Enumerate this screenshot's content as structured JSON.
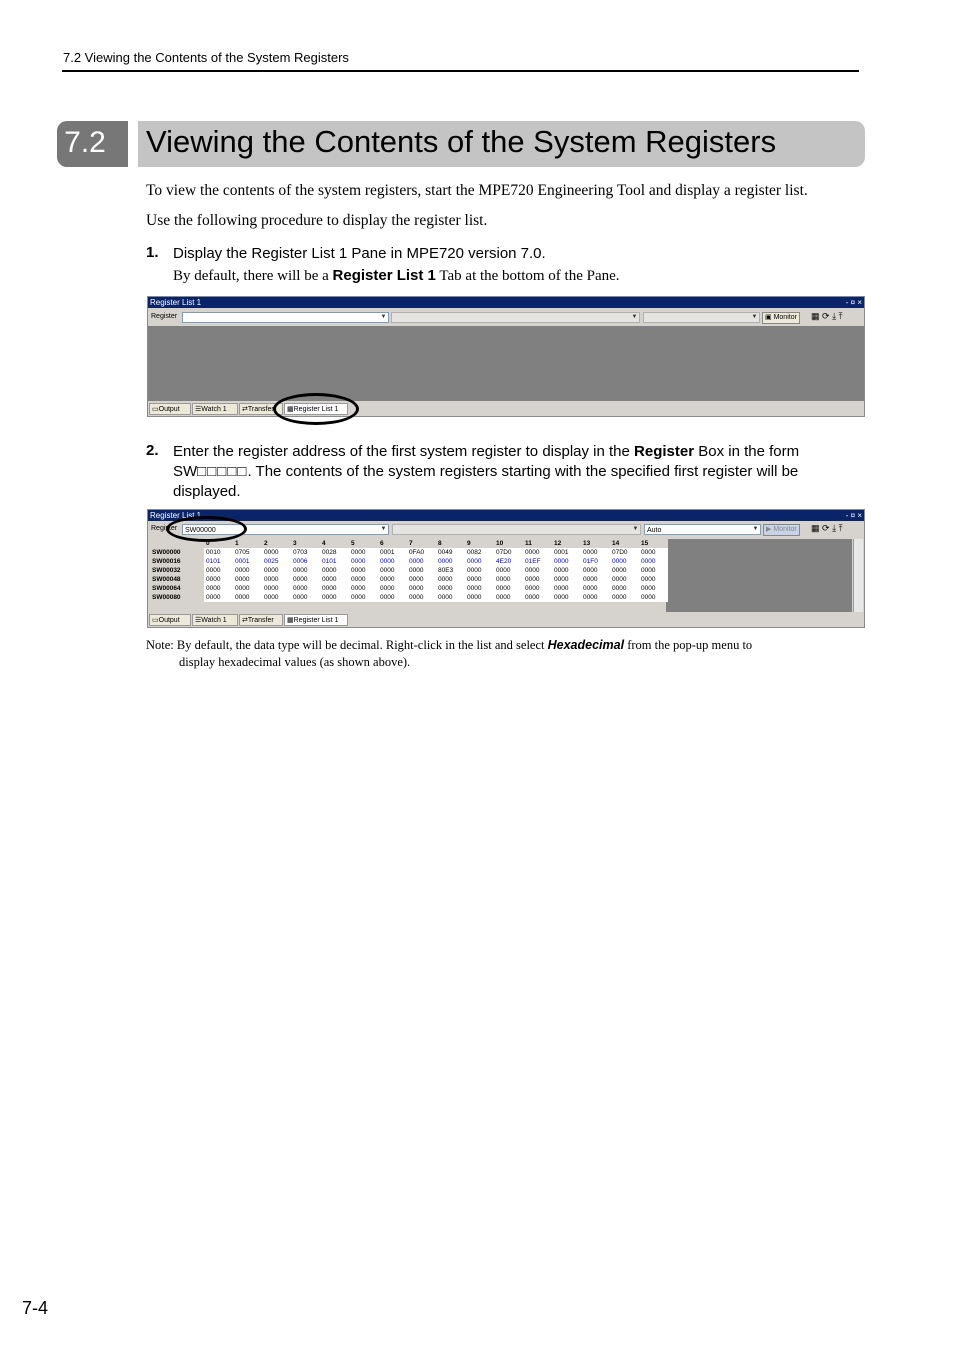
{
  "running_header": "7.2  Viewing the Contents of the System Registers",
  "section": {
    "number": "7.2",
    "title": "Viewing the Contents of the System Registers"
  },
  "intro": [
    "To view the contents of the system registers, start the MPE720 Engineering Tool and display a register list.",
    "Use the following procedure to display the register list."
  ],
  "steps": [
    {
      "number": "1.",
      "text": "Display the Register List 1 Pane in MPE720 version 7.0.",
      "detail_before": "By default, there will be a ",
      "detail_bold": "Register List 1",
      "detail_after": " Tab at the bottom of the Pane."
    },
    {
      "number": "2.",
      "text_before": "Enter the register address of the first system register to display in the ",
      "text_bold": "Register",
      "text_after_1": " Box in the form SW",
      "text_boxes": "□□□□□",
      "text_after_2": ". The contents of the system registers starting with the specified first register will be displayed."
    }
  ],
  "screenshot1": {
    "title": "Register List 1",
    "controls": "- ¤ ×",
    "register_label": "Register",
    "monitor_label": "Monitor",
    "tabs": [
      "Output",
      "Watch 1",
      "Transfer",
      "Register List 1"
    ]
  },
  "screenshot2": {
    "title": "Register List 1",
    "controls": "- ¤ ×",
    "register_label": "Register",
    "register_value": "SW00000",
    "type_value": "Auto",
    "monitor_label": "Monitor",
    "tabs": [
      "Output",
      "Watch 1",
      "Transfer",
      "Register List 1"
    ],
    "columns": [
      "0",
      "1",
      "2",
      "3",
      "4",
      "5",
      "6",
      "7",
      "8",
      "9",
      "10",
      "11",
      "12",
      "13",
      "14",
      "15"
    ],
    "rows": [
      {
        "label": "SW00000",
        "values": [
          "0010",
          "0705",
          "0000",
          "0703",
          "0028",
          "0000",
          "0001",
          "0FA0",
          "0049",
          "0082",
          "07D0",
          "0000",
          "0001",
          "0000",
          "07D0",
          "0000"
        ]
      },
      {
        "label": "SW00016",
        "values": [
          "0101",
          "0001",
          "0025",
          "0006",
          "0101",
          "0000",
          "0000",
          "0000",
          "0000",
          "0000",
          "4E20",
          "01EF",
          "0000",
          "01F0",
          "0000",
          "0000"
        ]
      },
      {
        "label": "SW00032",
        "values": [
          "0000",
          "0000",
          "0000",
          "0000",
          "0000",
          "0000",
          "0000",
          "0000",
          "80E3",
          "0000",
          "0000",
          "0000",
          "0000",
          "0000",
          "0000",
          "0000"
        ]
      },
      {
        "label": "SW00048",
        "values": [
          "0000",
          "0000",
          "0000",
          "0000",
          "0000",
          "0000",
          "0000",
          "0000",
          "0000",
          "0000",
          "0000",
          "0000",
          "0000",
          "0000",
          "0000",
          "0000"
        ]
      },
      {
        "label": "SW00064",
        "values": [
          "0000",
          "0000",
          "0000",
          "0000",
          "0000",
          "0000",
          "0000",
          "0000",
          "0000",
          "0000",
          "0000",
          "0000",
          "0000",
          "0000",
          "0000",
          "0000"
        ]
      },
      {
        "label": "SW00080",
        "values": [
          "0000",
          "0000",
          "0000",
          "0000",
          "0000",
          "0000",
          "0000",
          "0000",
          "0000",
          "0000",
          "0000",
          "0000",
          "0000",
          "0000",
          "0000",
          "0000"
        ]
      }
    ]
  },
  "note": {
    "before": "Note: By default, the data type will be decimal. Right-click in the list and select ",
    "bold": "Hexadecimal",
    "after": " from the pop-up menu to",
    "line2": "display hexadecimal values (as shown above)."
  },
  "page_number": "7-4"
}
